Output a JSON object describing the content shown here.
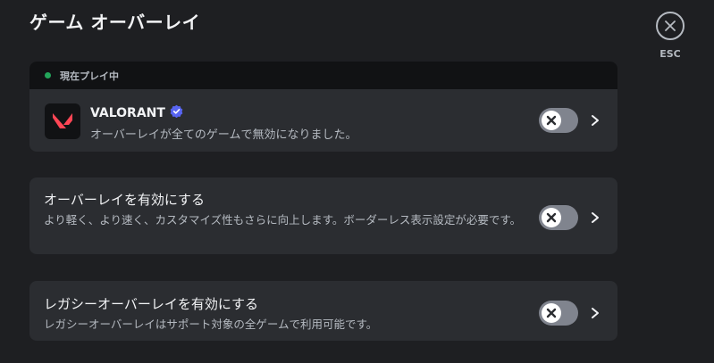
{
  "header": {
    "title": "ゲーム オーバーレイ",
    "esc_label": "ESC"
  },
  "now_playing": {
    "header_label": "現在プレイ中",
    "status_color": "#23a55a",
    "game": {
      "name": "VALORANT",
      "verified": true,
      "description": "オーバーレイが全てのゲームで無効になりました。",
      "overlay_enabled": false
    }
  },
  "settings": {
    "enable_overlay": {
      "title": "オーバーレイを有効にする",
      "description": "より軽く、より速く、カスタマイズ性もさらに向上します。ボーダーレス表示設定が必要です。",
      "enabled": false
    },
    "legacy_overlay": {
      "title": "レガシーオーバーレイを有効にする",
      "description": "レガシーオーバーレイはサポート対象の全ゲームで利用可能です。",
      "enabled": false
    }
  },
  "colors": {
    "background": "#1e1f22",
    "card": "#2b2d31",
    "toggle_off": "#80848e",
    "verified": "#5865f2",
    "valorant_red": "#ff4655"
  }
}
